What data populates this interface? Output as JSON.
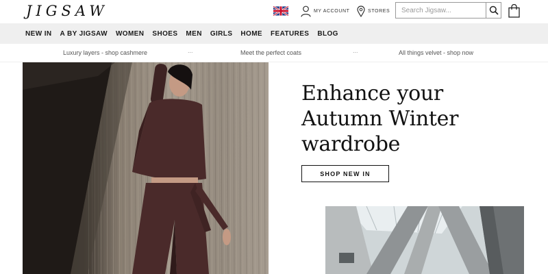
{
  "header": {
    "logo": "JIGSAW",
    "account_label": "MY ACCOUNT",
    "stores_label": "STORES",
    "search_placeholder": "Search Jigsaw..."
  },
  "nav": {
    "items": [
      "NEW IN",
      "A BY JIGSAW",
      "WOMEN",
      "SHOES",
      "MEN",
      "GIRLS",
      "HOME",
      "FEATURES",
      "BLOG"
    ]
  },
  "promo": {
    "items": [
      "Luxury layers - shop cashmere",
      "Meet the perfect coats",
      "All things velvet - shop now"
    ],
    "separator": "..."
  },
  "hero": {
    "headline_lines": [
      "Enhance your",
      "Autumn Winter",
      "wardrobe"
    ],
    "cta_label": "SHOP NEW IN"
  },
  "icons": {
    "flag": "uk-flag-icon",
    "account": "user-icon",
    "stores": "location-pin-icon",
    "search": "search-icon",
    "bag": "shopping-bag-icon"
  },
  "colors": {
    "nav_background": "#efefef",
    "text": "#1a1a1a",
    "outfit": "#4a2a2a"
  }
}
